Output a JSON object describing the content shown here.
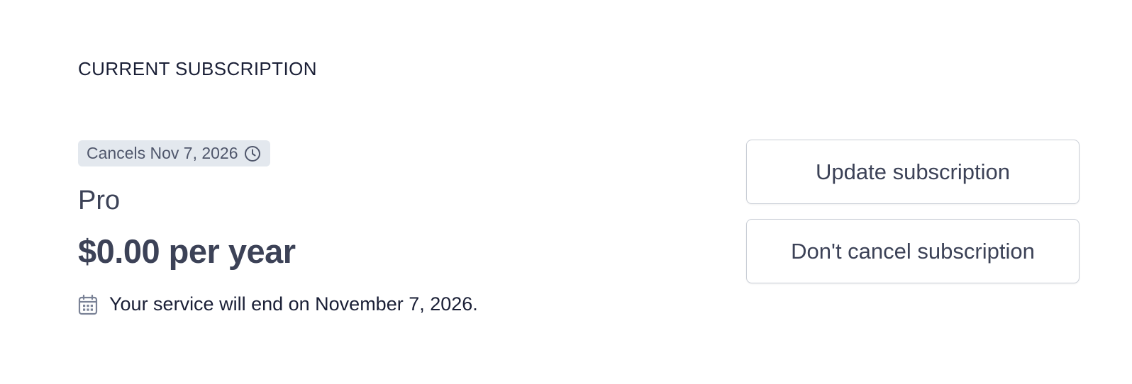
{
  "section": {
    "title": "CURRENT SUBSCRIPTION"
  },
  "subscription": {
    "status_badge": "Cancels Nov 7, 2026",
    "status_icon": "clock-icon",
    "plan_name": "Pro",
    "price": "$0.00 per year",
    "end_note": "Your service will end on November 7, 2026.",
    "end_note_icon": "calendar-icon"
  },
  "actions": {
    "update_label": "Update subscription",
    "keep_label": "Don't cancel subscription"
  },
  "colors": {
    "badge_bg": "#e3e8ee",
    "text_primary": "#1a1f36",
    "text_secondary": "#3c4257",
    "border": "#c9ced6"
  }
}
